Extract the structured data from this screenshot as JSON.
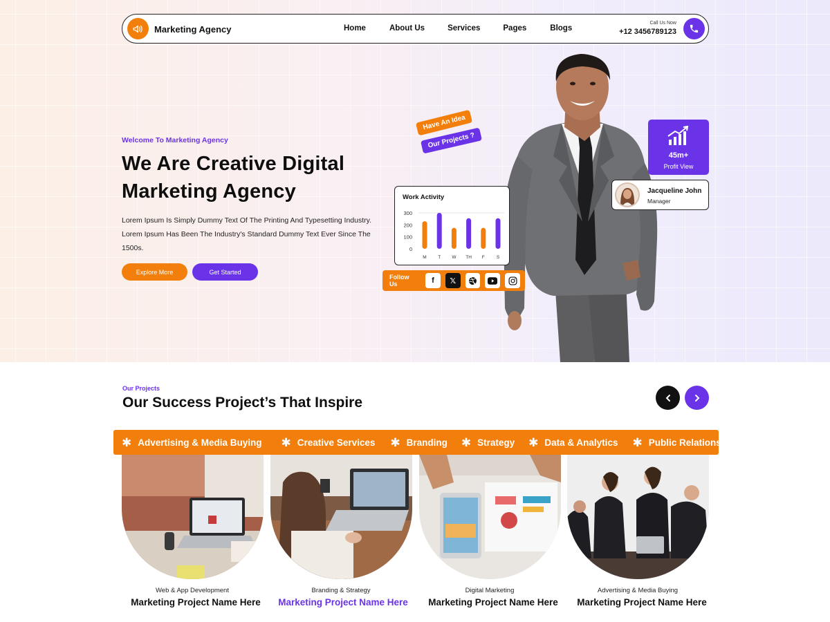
{
  "nav": {
    "brand": "Marketing Agency",
    "links": [
      "Home",
      "About Us",
      "Services",
      "Pages",
      "Blogs"
    ],
    "call_label": "Call Us Now",
    "call_number": "+12 3456789123"
  },
  "hero": {
    "eyebrow": "Welcome To Marketing Agency",
    "title": "We Are Creative Digital Marketing Agency",
    "description": "Lorem Ipsum Is Simply Dummy Text Of The Printing And Typesetting Industry. Lorem Ipsum Has Been The Industry's Standard Dummy Text Ever Since The 1500s.",
    "btn_primary": "Explore More",
    "btn_secondary": "Get Started",
    "sticker_1": "Have An Idea",
    "sticker_2": "Our Projects ?"
  },
  "work_activity": {
    "title": "Work Activity",
    "y_ticks": [
      "300",
      "200",
      "100",
      "0"
    ],
    "days": [
      "M",
      "T",
      "W",
      "TH",
      "F",
      "S"
    ],
    "bars": [
      {
        "orange": 230,
        "purple": null
      },
      {
        "orange": null,
        "purple": 300
      },
      {
        "orange": 175,
        "purple": null
      },
      {
        "orange": null,
        "purple": 255
      },
      {
        "orange": 175,
        "purple": null
      },
      {
        "orange": null,
        "purple": 255
      }
    ],
    "colors": {
      "orange": "#f27f0c",
      "purple": "#6b33e8"
    }
  },
  "follow": {
    "label": "Follow Us",
    "icons": [
      "facebook-icon",
      "x-icon",
      "dribbble-icon",
      "youtube-icon",
      "instagram-icon"
    ]
  },
  "profit": {
    "value": "45m+",
    "label": "Profit View"
  },
  "manager": {
    "name": "Jacqueline John",
    "role": "Manager"
  },
  "projects": {
    "eyebrow": "Our Projects",
    "title": "Our Success Project’s That Inspire",
    "services": [
      "Advertising & Media Buying",
      "Creative Services",
      "Branding",
      "Strategy",
      "Data & Analytics",
      "Public Relations"
    ],
    "items": [
      {
        "category": "Web & App Development",
        "name": "Marketing Project Name Here"
      },
      {
        "category": "Branding & Strategy",
        "name": "Marketing Project Name Here"
      },
      {
        "category": "Digital Marketing",
        "name": "Marketing Project Name Here"
      },
      {
        "category": "Advertising & Media Buying",
        "name": "Marketing Project Name Here"
      }
    ]
  },
  "colors": {
    "accent_orange": "#f27f0c",
    "accent_purple": "#6b33e8",
    "dark": "#111111"
  }
}
